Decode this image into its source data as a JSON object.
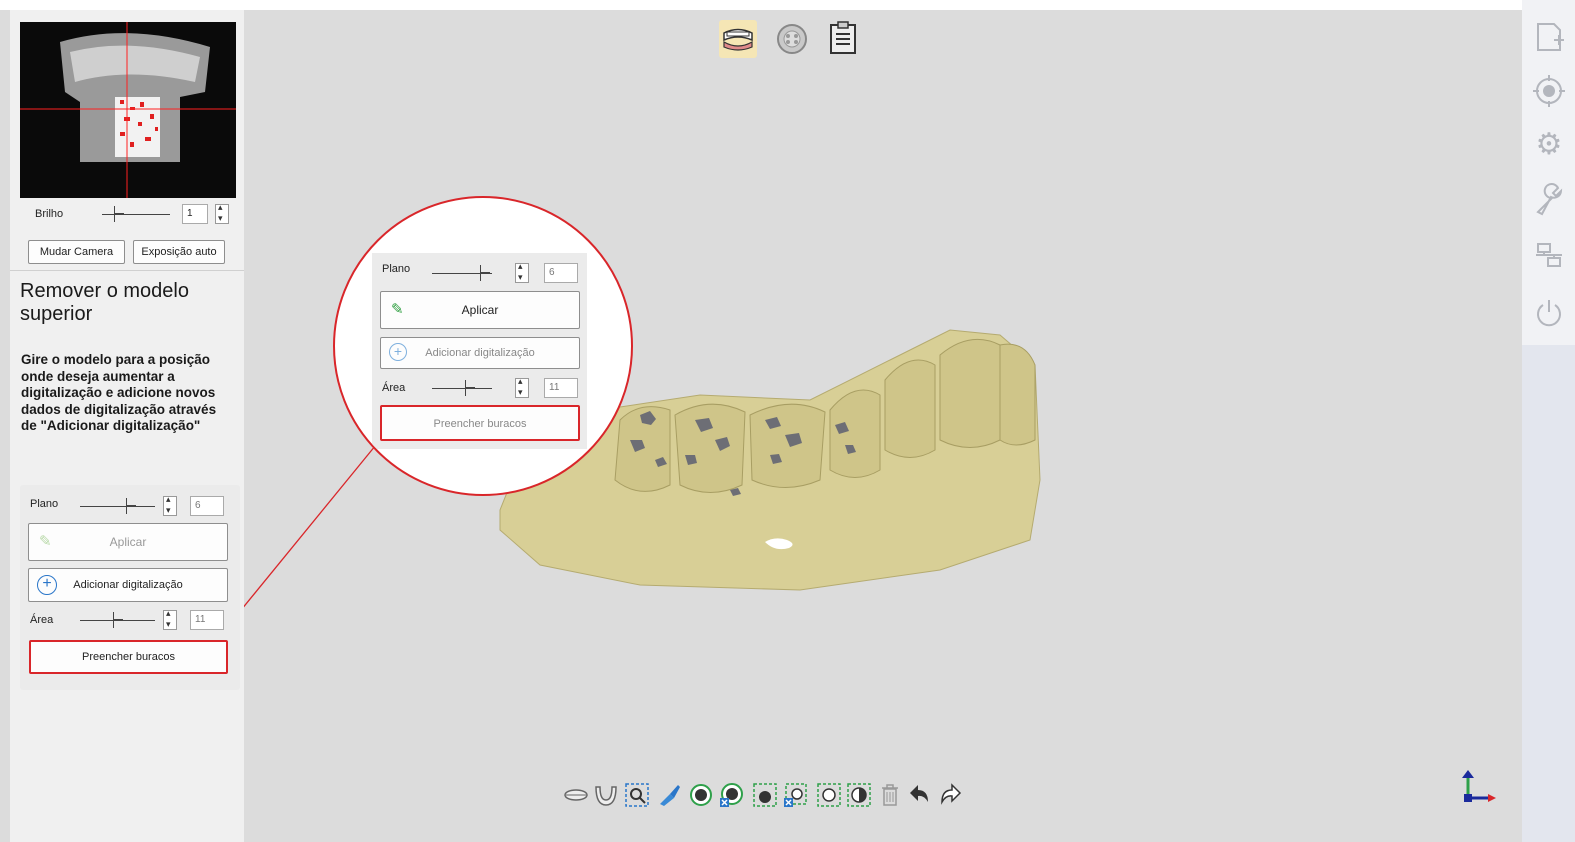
{
  "camera": {
    "brightness_label": "Brilho",
    "brightness_value": "1",
    "switch_camera_label": "Mudar Camera",
    "auto_exposure_label": "Exposição auto"
  },
  "panel": {
    "title": "Remover o modelo superior",
    "description": "Gire o modelo para a posição onde deseja aumentar a digitalização e adicione novos dados de digitalização através de \"Adicionar digitalização\"",
    "plane_label": "Plano",
    "plane_value": "6",
    "apply_label": "Aplicar",
    "add_scan_label": "Adicionar digitalização",
    "area_label": "Área",
    "area_value": "11",
    "fill_holes_label": "Preencher buracos"
  },
  "zoom": {
    "plane_label": "Plano",
    "plane_value": "6",
    "apply_label": "Aplicar",
    "add_scan_label": "Adicionar digitalização",
    "area_label": "Área",
    "area_value": "11",
    "fill_holes_label": "Preencher buracos"
  },
  "colors": {
    "highlight": "#d9262a",
    "model": "#d8cf96",
    "hole": "#6d6e75",
    "accent_blue": "#2a76c9"
  },
  "icons": {
    "top": [
      "jaw-mode-icon",
      "scan-mode-icon",
      "clipboard-icon"
    ],
    "right": [
      "new-case-icon",
      "target-icon",
      "settings-icon",
      "wrench-icon",
      "network-icon",
      "power-icon"
    ],
    "bottom": [
      "upper-jaw-icon",
      "lower-jaw-icon",
      "zoom-fit-icon",
      "brush-select-icon",
      "view-select-icon",
      "view-deselect-icon",
      "box-select-icon",
      "box-deselect-icon",
      "rect-select-icon",
      "invert-select-icon",
      "delete-icon",
      "undo-icon",
      "redo-icon"
    ]
  }
}
